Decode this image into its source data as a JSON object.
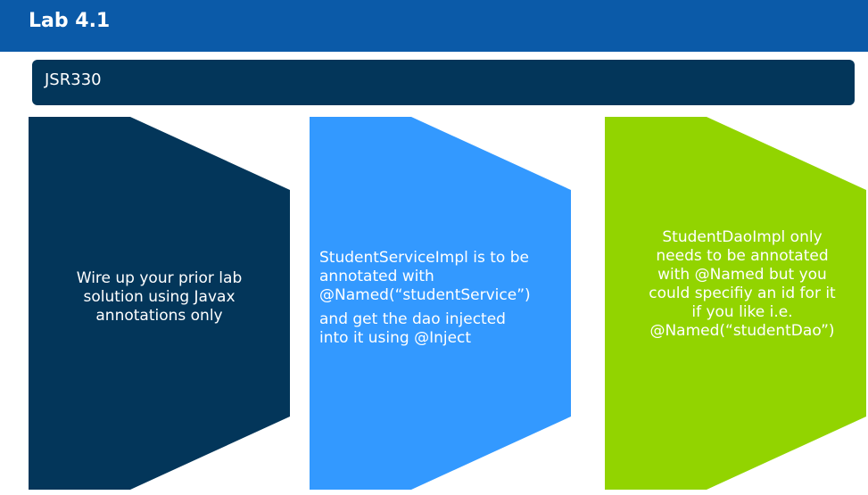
{
  "slide": {
    "title": "Lab 4.1",
    "header": "JSR330"
  },
  "colors": {
    "title_bar": "#0b5aa8",
    "header_banner": "#03365a",
    "shape1": "#03365a",
    "shape2": "#3399ff",
    "shape3": "#92d400",
    "text": "#ffffff"
  },
  "steps": [
    {
      "lines": [
        "Wire up your prior lab",
        "solution using Javax",
        "annotations only"
      ]
    },
    {
      "para1_lines": [
        "StudentServiceImpl is to be",
        "annotated with",
        "@Named(“studentService”)"
      ],
      "para2_lines": [
        "and get the dao injected",
        "into it using @Inject"
      ]
    },
    {
      "lines": [
        "StudentDaoImpl only",
        "needs to be annotated",
        "with @Named but you",
        "could specifiy an id for it",
        "if you like i.e.",
        "@Named(“studentDao”)"
      ]
    }
  ]
}
